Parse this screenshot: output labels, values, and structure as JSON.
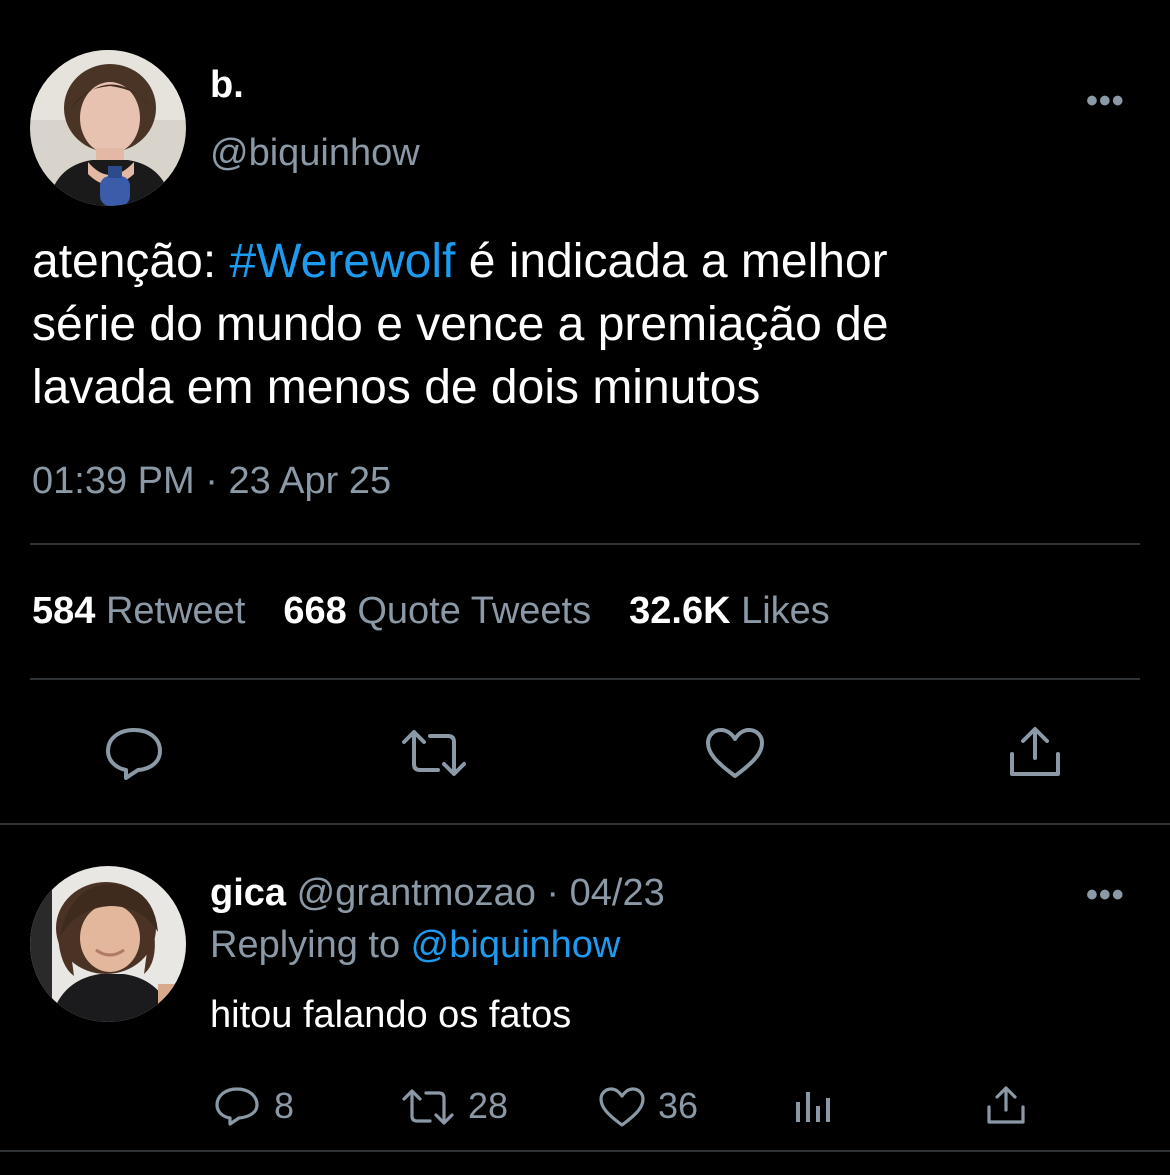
{
  "main_tweet": {
    "display_name": "b.",
    "handle": "@biquinhow",
    "more_label": "•••",
    "text_before": "atenção: ",
    "hashtag": "#Werewolf",
    "text_line1_after": " é indicada a melhor",
    "text_line2": "série do mundo e vence a premiação de",
    "text_line3": "lavada em menos de dois minutos",
    "time": "01:39 PM",
    "separator": " · ",
    "date": "23 Apr 25",
    "stats": {
      "retweets_count": "584",
      "retweets_label": "Retweet",
      "quotes_count": "668",
      "quotes_label": "Quote Tweets",
      "likes_count": "32.6K",
      "likes_label": "Likes"
    },
    "actions": [
      "reply-icon",
      "retweet-icon",
      "heart-icon",
      "share-icon"
    ]
  },
  "reply": {
    "display_name": "gica",
    "handle": "@grantmozao",
    "separator": " · ",
    "date": "04/23",
    "replying_to_label": "Replying to ",
    "replying_to_handle": "@biquinhow",
    "text": "hitou falando os fatos",
    "more_label": "•••",
    "reply_count": "8",
    "retweet_count": "28",
    "like_count": "36"
  },
  "colors": {
    "background": "#000000",
    "text": "#ffffff",
    "secondary": "#8b98a5",
    "accent": "#1d9bf0",
    "divider": "#2f3336"
  }
}
